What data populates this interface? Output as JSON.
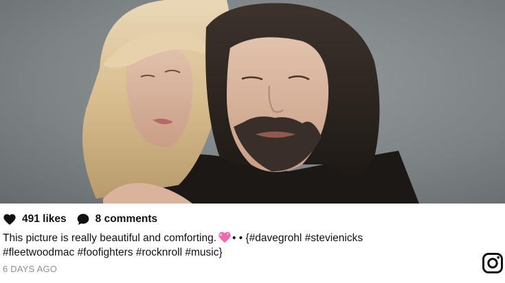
{
  "post": {
    "image_alt": "Stevie Nicks and Dave Grohl portrait",
    "likes": "491 likes",
    "comments": "8 comments",
    "caption_line1": "This picture is really beautiful and comforting.",
    "caption_dots": "• • {#davegrohl #stevienicks",
    "caption_line2": "#fleetwoodmac #foofighters #rocknroll #music}",
    "timestamp": "6 DAYS AGO"
  },
  "icons": {
    "like": "heart-icon",
    "comment": "speech-bubble-icon",
    "emoji": "sparkling-heart-emoji",
    "brand": "instagram-icon"
  },
  "colors": {
    "text": "#111111",
    "muted": "#8e8e8e",
    "emoji_pink": "#f06ab0"
  }
}
